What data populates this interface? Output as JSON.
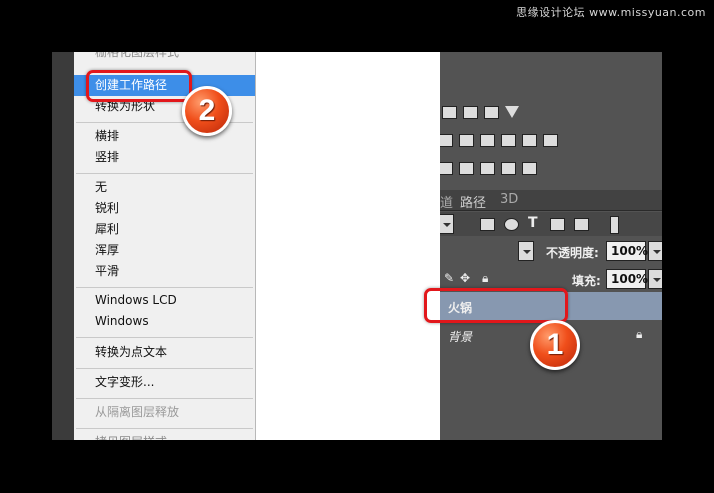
{
  "watermark": "思缘设计论坛 www.missyuan.com",
  "menu": {
    "items": [
      {
        "label": "栅格化图层样式",
        "state": "cut"
      },
      {
        "label": "创建工作路径",
        "state": "highlighted"
      },
      {
        "label": "转换为形状",
        "state": "normal"
      },
      {
        "label": "横排",
        "state": "normal"
      },
      {
        "label": "竖排",
        "state": "normal"
      },
      {
        "label": "无",
        "state": "normal"
      },
      {
        "label": "锐利",
        "state": "normal"
      },
      {
        "label": "犀利",
        "state": "normal"
      },
      {
        "label": "浑厚",
        "state": "normal"
      },
      {
        "label": "平滑",
        "state": "normal"
      },
      {
        "label": "Windows LCD",
        "state": "normal"
      },
      {
        "label": "Windows",
        "state": "normal"
      },
      {
        "label": "转换为点文本",
        "state": "normal"
      },
      {
        "label": "文字变形...",
        "state": "normal"
      },
      {
        "label": "从隔离图层释放",
        "state": "disabled"
      },
      {
        "label": "拷贝图层样式",
        "state": "cut"
      }
    ]
  },
  "layers_panel": {
    "tabs": [
      "道",
      "路径",
      "3D"
    ],
    "opacity_label": "不透明度:",
    "opacity_value": "100%",
    "fill_label": "填充:",
    "fill_value": "100%",
    "layers": [
      {
        "name": "火锅",
        "selected": true
      },
      {
        "name": "背景",
        "selected": false,
        "locked": true
      }
    ]
  },
  "callouts": {
    "badge_1": "1",
    "badge_2": "2"
  },
  "colors": {
    "highlight": "#3d8ee8",
    "callout": "#e2171b",
    "selected_layer": "#8798b0"
  }
}
